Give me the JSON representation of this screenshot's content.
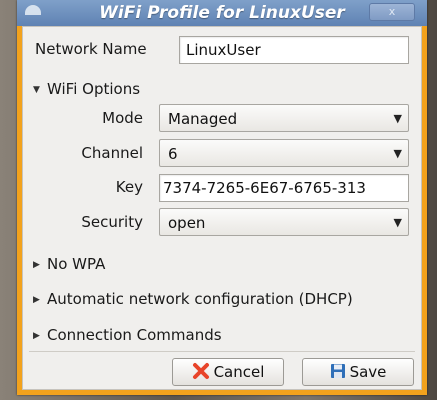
{
  "window": {
    "title": "WiFi Profile for LinuxUser",
    "close_label": "x"
  },
  "form": {
    "network_name_label": "Network Name",
    "network_name_value": "LinuxUser",
    "wifi_options_label": "WiFi Options",
    "mode_label": "Mode",
    "mode_value": "Managed",
    "channel_label": "Channel",
    "channel_value": "6",
    "key_label": "Key",
    "key_value": "7374-7265-6E67-6765-313",
    "security_label": "Security",
    "security_value": "open"
  },
  "sections": {
    "no_wpa": "No WPA",
    "dhcp": "Automatic network configuration (DHCP)",
    "commands": "Connection Commands"
  },
  "buttons": {
    "cancel_label": "Cancel",
    "save_label": "Save"
  },
  "icons": {
    "window_menu": "window-menu-icon",
    "close": "close-icon",
    "expanded": "triangle-down-icon",
    "collapsed": "triangle-right-icon",
    "combo_arrow": "chevron-down-icon",
    "cancel": "cancel-x-icon",
    "save": "floppy-disk-icon"
  },
  "colors": {
    "window_border": "#f2a21d",
    "titlebar": "#6f90bf",
    "panel_bg": "#f0efed",
    "cancel_icon": "#e8442a",
    "save_icon": "#2f6fb8"
  }
}
